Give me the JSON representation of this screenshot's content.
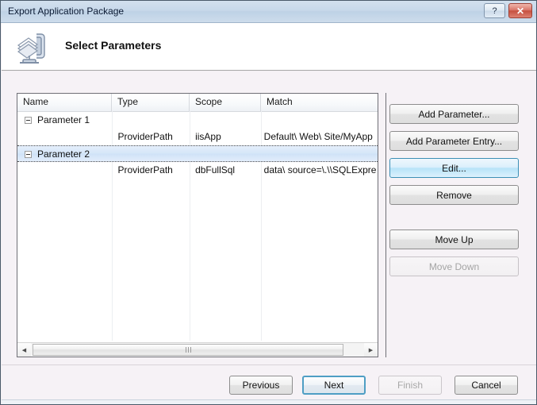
{
  "window": {
    "title": "Export Application Package",
    "help_label": "?",
    "close_label": "✕"
  },
  "header": {
    "title": "Select Parameters",
    "icon": "package-export-icon"
  },
  "list": {
    "columns": [
      "Name",
      "Type",
      "Scope",
      "Match"
    ],
    "rows": [
      {
        "kind": "group",
        "name": "Parameter 1",
        "type": "",
        "scope": "",
        "match": "",
        "selected": false
      },
      {
        "kind": "entry",
        "name": "",
        "type": "ProviderPath",
        "scope": "iisApp",
        "match": "Default\\ Web\\ Site/MyApp",
        "selected": false
      },
      {
        "kind": "group",
        "name": "Parameter 2",
        "type": "",
        "scope": "",
        "match": "",
        "selected": true
      },
      {
        "kind": "entry",
        "name": "",
        "type": "ProviderPath",
        "scope": "dbFullSql",
        "match": "data\\ source=\\.\\\\SQLExpre",
        "selected": false
      }
    ],
    "scrollbar": {
      "left_arrow": "◀",
      "right_arrow": "▶",
      "grip": "|||"
    }
  },
  "side_buttons": [
    {
      "label": "Add Parameter...",
      "state": "normal"
    },
    {
      "label": "Add Parameter Entry...",
      "state": "normal"
    },
    {
      "label": "Edit...",
      "state": "hover"
    },
    {
      "label": "Remove",
      "state": "normal"
    },
    {
      "label": "Move Up",
      "state": "normal"
    },
    {
      "label": "Move Down",
      "state": "disabled"
    }
  ],
  "footer_buttons": [
    {
      "label": "Previous",
      "state": "normal"
    },
    {
      "label": "Next",
      "state": "default"
    },
    {
      "label": "Finish",
      "state": "disabled"
    },
    {
      "label": "Cancel",
      "state": "normal"
    }
  ],
  "colors": {
    "titlebar": "#c7d8ea",
    "dialog_bg": "#f6f2f6",
    "selection": "#d5e6f8",
    "accent": "#4e9ec4",
    "close_red": "#c6503f"
  }
}
